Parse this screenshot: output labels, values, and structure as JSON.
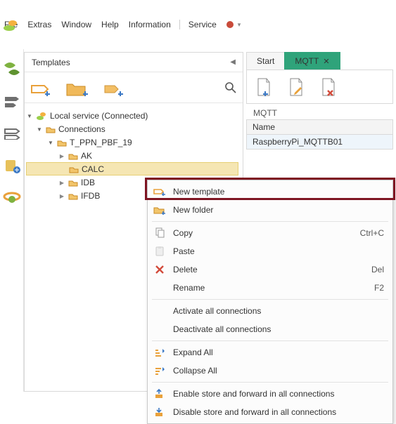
{
  "menu": {
    "file": "File",
    "extras": "Extras",
    "window": "Window",
    "help": "Help",
    "information": "Information",
    "service": "Service"
  },
  "panel": {
    "title": "Templates"
  },
  "tree": {
    "root": "Local service (Connected)",
    "connections": "Connections",
    "group": "T_PPN_PBF_19",
    "items": [
      "AK",
      "CALC",
      "IDB",
      "IFDB"
    ]
  },
  "tabs": {
    "start": "Start",
    "mqtt": "MQTT"
  },
  "mqtt": {
    "section": "MQTT",
    "colName": "Name",
    "row0": "RaspberryPi_MQTTB01"
  },
  "ctx": {
    "newTemplate": "New template",
    "newFolder": "New folder",
    "copy": "Copy",
    "copySc": "Ctrl+C",
    "paste": "Paste",
    "delete": "Delete",
    "deleteSc": "Del",
    "rename": "Rename",
    "renameSc": "F2",
    "activate": "Activate all connections",
    "deactivate": "Deactivate all connections",
    "expand": "Expand All",
    "collapse": "Collapse All",
    "enableSF": "Enable store and forward in all connections",
    "disableSF": "Disable store and forward in all connections"
  }
}
